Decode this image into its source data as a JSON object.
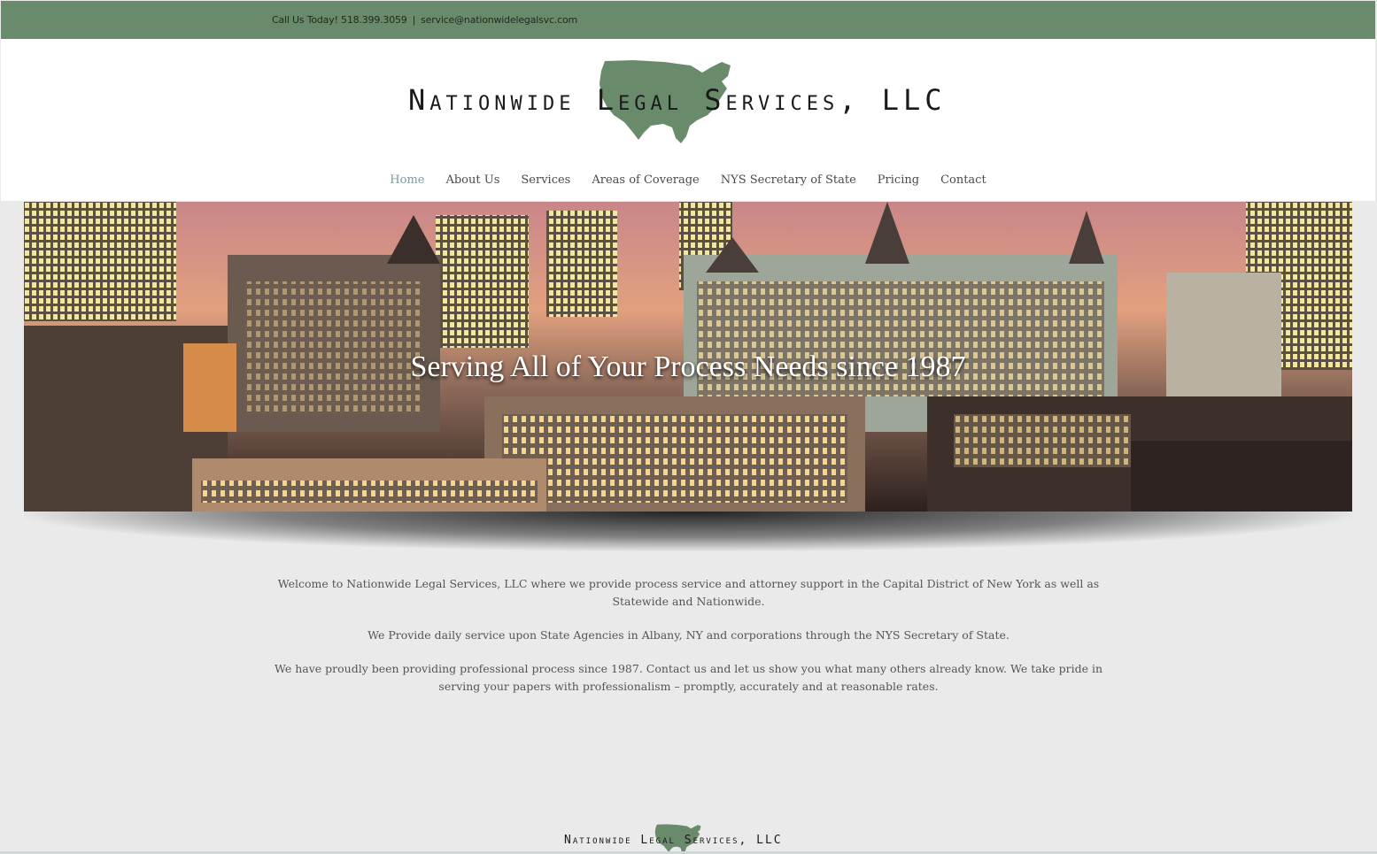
{
  "topbar": {
    "call_label": "Call Us Today! 518.399.3059",
    "separator": "|",
    "email": "service@nationwidelegalsvc.com",
    "color": "#6a8a6c"
  },
  "header": {
    "logo_text": "Nationwide Legal Services, LLC",
    "logo_icon": "usa-map-icon"
  },
  "nav": {
    "items": [
      {
        "label": "Home",
        "active": true
      },
      {
        "label": "About Us"
      },
      {
        "label": "Services"
      },
      {
        "label": "Areas of Coverage"
      },
      {
        "label": "NYS Secretary of State"
      },
      {
        "label": "Pricing"
      },
      {
        "label": "Contact"
      }
    ],
    "active_color": "#7a9a9c"
  },
  "hero": {
    "title": "Serving All of Your Process Needs since 1987"
  },
  "content": {
    "paragraphs": [
      "Welcome to Nationwide Legal Services, LLC where we provide process service and attorney support in the Capital District of New York as well as Statewide and Nationwide.",
      "We Provide daily service upon State Agencies in Albany, NY and corporations through the NYS Secretary of State.",
      "We have proudly been providing professional process since 1987. Contact us and let us show you what many others already know. We take pride in serving your papers with professionalism – promptly, accurately and at reasonable rates."
    ]
  },
  "footer": {
    "logo_text": "Nationwide Legal Services, LLC"
  }
}
